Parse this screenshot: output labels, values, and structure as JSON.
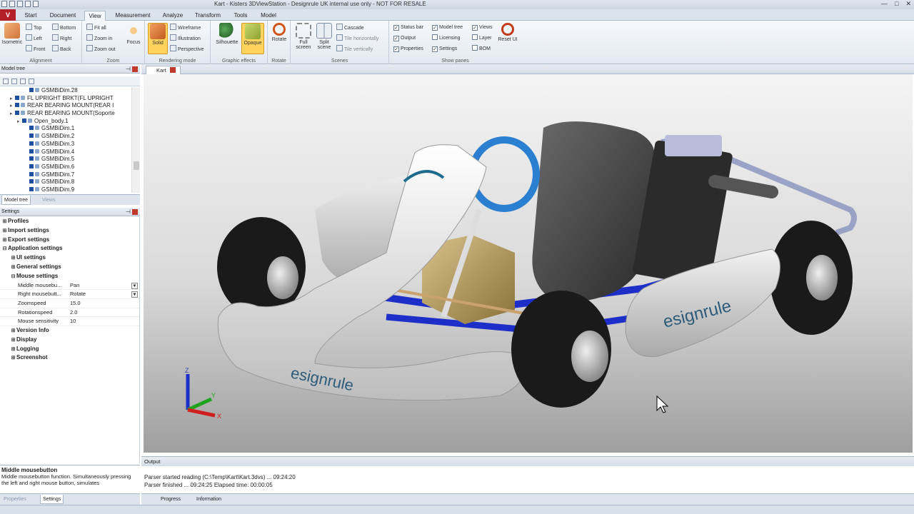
{
  "window": {
    "title": "Kart - Kisters 3DViewStation - Designrule UK internal use only - NOT FOR RESALE",
    "controls": [
      "—",
      "□",
      "✕"
    ]
  },
  "app_button": "V",
  "tabs": [
    {
      "label": "Start"
    },
    {
      "label": "Document"
    },
    {
      "label": "View",
      "active": true
    },
    {
      "label": "Measurement"
    },
    {
      "label": "Analyze"
    },
    {
      "label": "Transform"
    },
    {
      "label": "Tools"
    },
    {
      "label": "Model"
    }
  ],
  "ribbon": {
    "alignment": {
      "group": "Alignment",
      "isometric": "Isometric",
      "top": "Top",
      "left": "Left",
      "front": "Front",
      "bottom": "Bottom",
      "right": "Right",
      "back": "Back"
    },
    "zoom": {
      "group": "Zoom",
      "fit_all": "Fit all",
      "zoom_in": "Zoom in",
      "zoom_out": "Zoom out",
      "focus": "Focus"
    },
    "rendering": {
      "group": "Rendering mode",
      "solid": "Solid",
      "wireframe": "Wireframe",
      "illustration": "Illustration",
      "perspective": "Perspective"
    },
    "effects": {
      "group": "Graphic effects",
      "silhouette": "Silhouette",
      "opaque": "Opaque"
    },
    "rotate": {
      "group": "Rotate",
      "rotate": "Rotate"
    },
    "scenes": {
      "group": "Scenes",
      "full_screen": "Full screen",
      "split_scene": "Split scene",
      "cascade": "Cascade",
      "tile_h": "Tile horizontally",
      "tile_v": "Tile vertically"
    },
    "show_panes": {
      "group": "Show panes",
      "status_bar": "Status bar",
      "output": "Output",
      "properties": "Properties",
      "model_tree": "Model tree",
      "licensing": "Licensing",
      "settings": "Settings",
      "views": "Views",
      "layer": "Layer",
      "bom": "BOM",
      "reset_ui": "Reset UI"
    }
  },
  "model_tree": {
    "title": "Model tree",
    "rows": [
      {
        "label": "GSMBiDim.28",
        "indent": 3
      },
      {
        "label": "FL UPRIGHT BRKT(FL UPRIGHT",
        "indent": 1
      },
      {
        "label": "REAR BEARING MOUNT(REAR I",
        "indent": 1
      },
      {
        "label": "REAR BEARING MOUNT(Soporte",
        "indent": 1
      },
      {
        "label": "Open_body.1",
        "indent": 2
      },
      {
        "label": "GSMBiDim.1",
        "indent": 3
      },
      {
        "label": "GSMBiDim.2",
        "indent": 3
      },
      {
        "label": "GSMBiDim.3",
        "indent": 3
      },
      {
        "label": "GSMBiDim.4",
        "indent": 3
      },
      {
        "label": "GSMBiDim.5",
        "indent": 3
      },
      {
        "label": "GSMBiDim.6",
        "indent": 3
      },
      {
        "label": "GSMBiDim.7",
        "indent": 3
      },
      {
        "label": "GSMBiDim.8",
        "indent": 3
      },
      {
        "label": "GSMBiDim.9",
        "indent": 3
      }
    ],
    "tabs": [
      "Model tree",
      "Views"
    ]
  },
  "settings": {
    "title": "Settings",
    "sections": [
      {
        "label": "Profiles",
        "level": 0,
        "expanded": false
      },
      {
        "label": "Import settings",
        "level": 0,
        "expanded": false
      },
      {
        "label": "Export settings",
        "level": 0,
        "expanded": false
      },
      {
        "label": "Application settings",
        "level": 0,
        "expanded": true
      },
      {
        "label": "UI settings",
        "level": 1,
        "expanded": false
      },
      {
        "label": "General settings",
        "level": 1,
        "expanded": false
      },
      {
        "label": "Mouse settings",
        "level": 1,
        "expanded": true
      }
    ],
    "mouse_props": [
      {
        "key": "Middle mousebu...",
        "value": "Pan",
        "dropdown": true
      },
      {
        "key": "Right mousebutt...",
        "value": "Rotate",
        "dropdown": true
      },
      {
        "key": "Zoomspeed",
        "value": "15.0"
      },
      {
        "key": "Rotationspeed",
        "value": "2.0"
      },
      {
        "key": "Mouse sensitivity",
        "value": "10"
      }
    ],
    "more_sections": [
      "Version Info",
      "Display",
      "Logging",
      "Screenshot"
    ]
  },
  "help": {
    "title": "Middle mousebutton",
    "text": "Middle mousebutton function. Simultaneously pressing the left and right mouse button, simulates"
  },
  "left_bottom_tabs": [
    "Properties",
    "Settings"
  ],
  "document_tab": "Kart",
  "viewport": {
    "logo_text": "esignrule",
    "axis_labels": {
      "z": "Z",
      "y": "Y",
      "x": "X"
    }
  },
  "output": {
    "title": "Output",
    "lines": [
      "Parser started reading (C:\\Temp\\Kart\\Kart.3dvs) ... 09:24:20",
      "Parser finished ... 09:24:25 Elapsed time: 00:00:05"
    ],
    "tabs": [
      "Progress",
      "Information"
    ]
  },
  "colors": {
    "brand_red": "#b3202a",
    "selected": "#ffd45e",
    "kart_blue": "#1d2fc8"
  }
}
